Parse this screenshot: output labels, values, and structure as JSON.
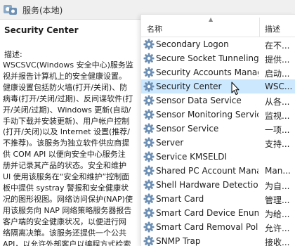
{
  "window": {
    "title": "服务(本地)"
  },
  "details": {
    "service_name": "Security Center",
    "description_label": "描述:",
    "description_lines": [
      "WSCSVC(Windows 安全中心)服务监",
      "视并报告计算机上的安全健康设置。",
      "健康设置包括防火墙(打开/关闭)、防",
      "病毒(打开/关闭/过期)、反间谍软件(打",
      "开/关闭/过期)、Windows 更新(自动/",
      "手动下载并安装更新)、用户帐户控制",
      "(打开/关闭)以及 Internet 设置(推荐/",
      "不推荐)。该服务为独立软件供应商提",
      "供 COM API 以便向安全中心服务注",
      "册并记录其产品的状态。安全和维护",
      "UI 使用该服务在“安全和维护”控制面",
      "板中提供 systray 警报和安全健康状",
      "况的图形视图。网络访问保护(NAP)使",
      "用该服务向 NAP 网络策略服务器报告",
      "客户端的安全健康状况，以便进行网",
      "络隔离决策。该服务还提供一个公共",
      "API，以允许外部客户以编程方式检索"
    ]
  },
  "list": {
    "columns": {
      "name": "名称",
      "description": "描述"
    },
    "rows": [
      {
        "name": "Secondary Logon",
        "desc": "在不..."
      },
      {
        "name": "Secure Socket Tunneling ...",
        "desc": "提供..."
      },
      {
        "name": "Security Accounts Manag...",
        "desc": "启动..."
      },
      {
        "name": "Security Center",
        "desc": "WSC...",
        "selected": true
      },
      {
        "name": "Sensor Data Service",
        "desc": "从各..."
      },
      {
        "name": "Sensor Monitoring Service",
        "desc": "监视..."
      },
      {
        "name": "Sensor Service",
        "desc": "一项..."
      },
      {
        "name": "Server",
        "desc": "支持..."
      },
      {
        "name": "Service KMSELDI",
        "desc": ""
      },
      {
        "name": "Shared PC Account Mana...",
        "desc": "Man..."
      },
      {
        "name": "Shell Hardware Detection",
        "desc": "为自..."
      },
      {
        "name": "Smart Card",
        "desc": "管理..."
      },
      {
        "name": "Smart Card Device Enum...",
        "desc": "为给..."
      },
      {
        "name": "Smart Card Removal Poli...",
        "desc": "允许..."
      },
      {
        "name": "SNMP Trap",
        "desc": "接收..."
      }
    ]
  },
  "icons": {
    "title": "services-icon",
    "row": "gear-icon",
    "cursor": "mouse-pointer-icon"
  },
  "colors": {
    "selection": "#cce8ff",
    "gear": "#6d8fb3",
    "title_bar": "#f0f0f0"
  }
}
